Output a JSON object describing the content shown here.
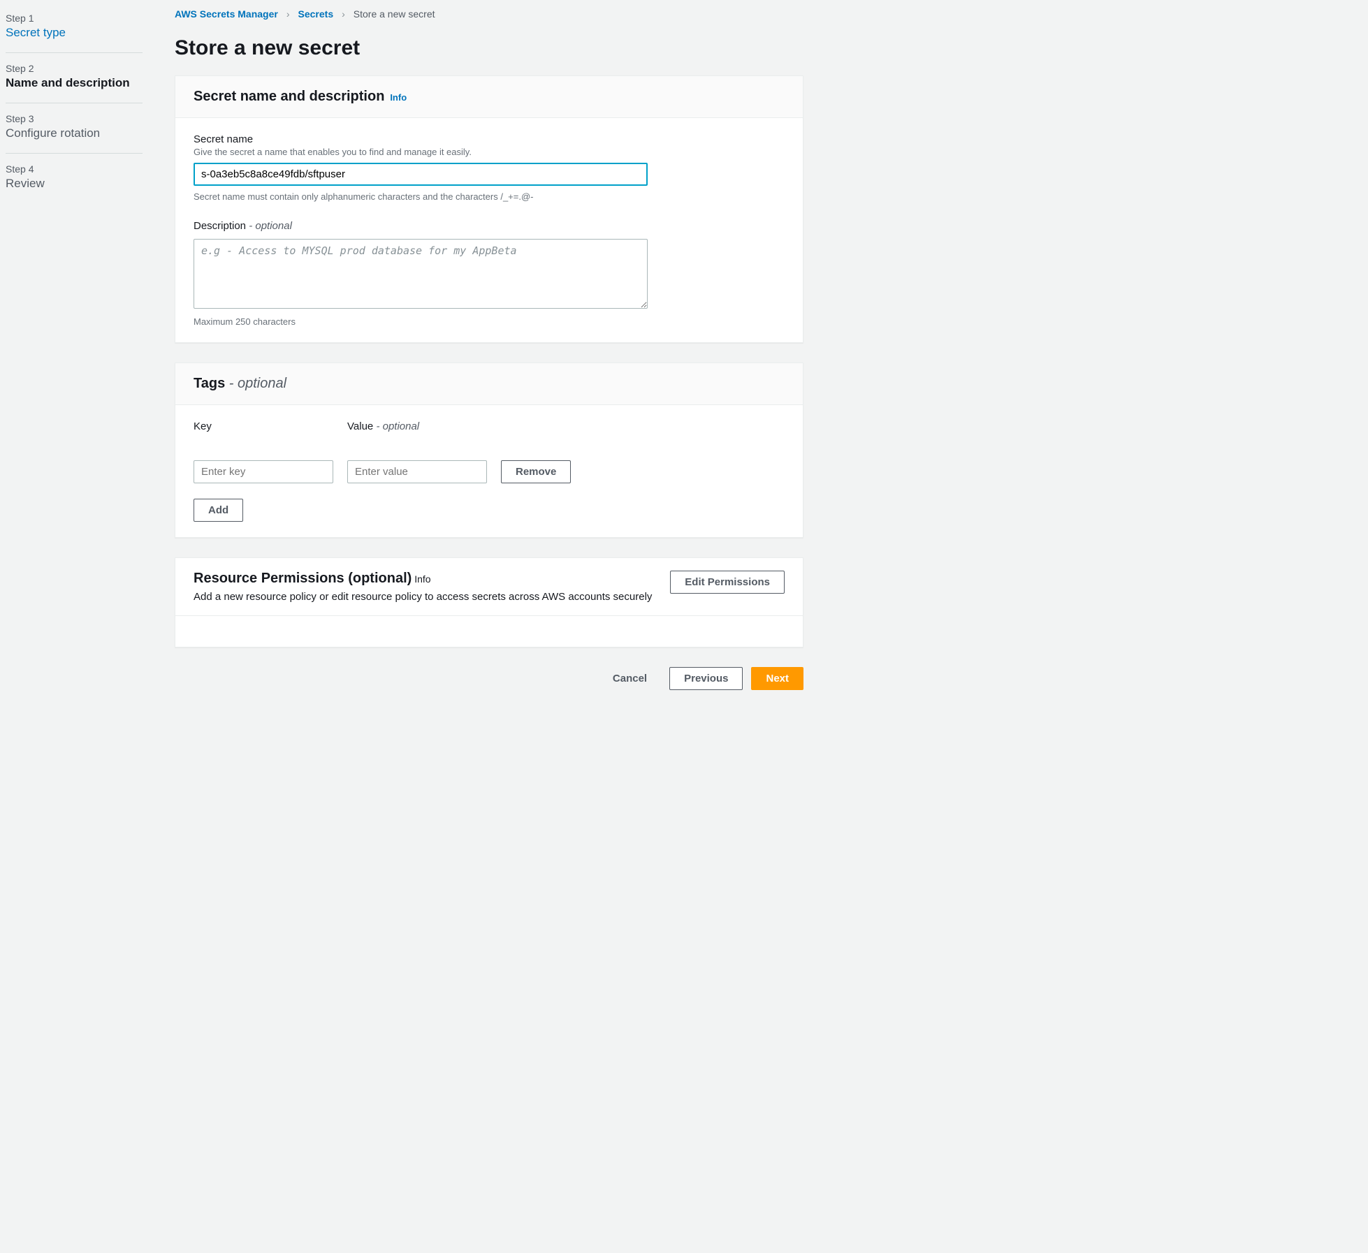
{
  "sidebar": {
    "steps": [
      {
        "label": "Step 1",
        "title": "Secret type"
      },
      {
        "label": "Step 2",
        "title": "Name and description"
      },
      {
        "label": "Step 3",
        "title": "Configure rotation"
      },
      {
        "label": "Step 4",
        "title": "Review"
      }
    ]
  },
  "breadcrumb": {
    "root": "AWS Secrets Manager",
    "mid": "Secrets",
    "current": "Store a new secret"
  },
  "page_title": "Store a new secret",
  "section_name_desc": {
    "title": "Secret name and description",
    "info": "Info",
    "secret_name_label": "Secret name",
    "secret_name_help": "Give the secret a name that enables you to find and manage it easily.",
    "secret_name_value": "s-0a3eb5c8a8ce49fdb/sftpuser",
    "secret_name_constraint": "Secret name must contain only alphanumeric characters and the characters /_+=.@-",
    "description_label": "Description",
    "description_optional": "- optional",
    "description_placeholder": "e.g - Access to MYSQL prod database for my AppBeta",
    "description_constraint": "Maximum 250 characters"
  },
  "section_tags": {
    "title": "Tags",
    "optional": "- optional",
    "key_label": "Key",
    "value_label": "Value",
    "value_optional": "- optional",
    "key_placeholder": "Enter key",
    "value_placeholder": "Enter value",
    "remove_label": "Remove",
    "add_label": "Add"
  },
  "section_perms": {
    "title": "Resource Permissions (optional)",
    "info": "Info",
    "subtext": "Add a new resource policy or edit resource policy to access secrets across AWS accounts securely",
    "edit_label": "Edit Permissions"
  },
  "footer": {
    "cancel": "Cancel",
    "previous": "Previous",
    "next": "Next"
  }
}
